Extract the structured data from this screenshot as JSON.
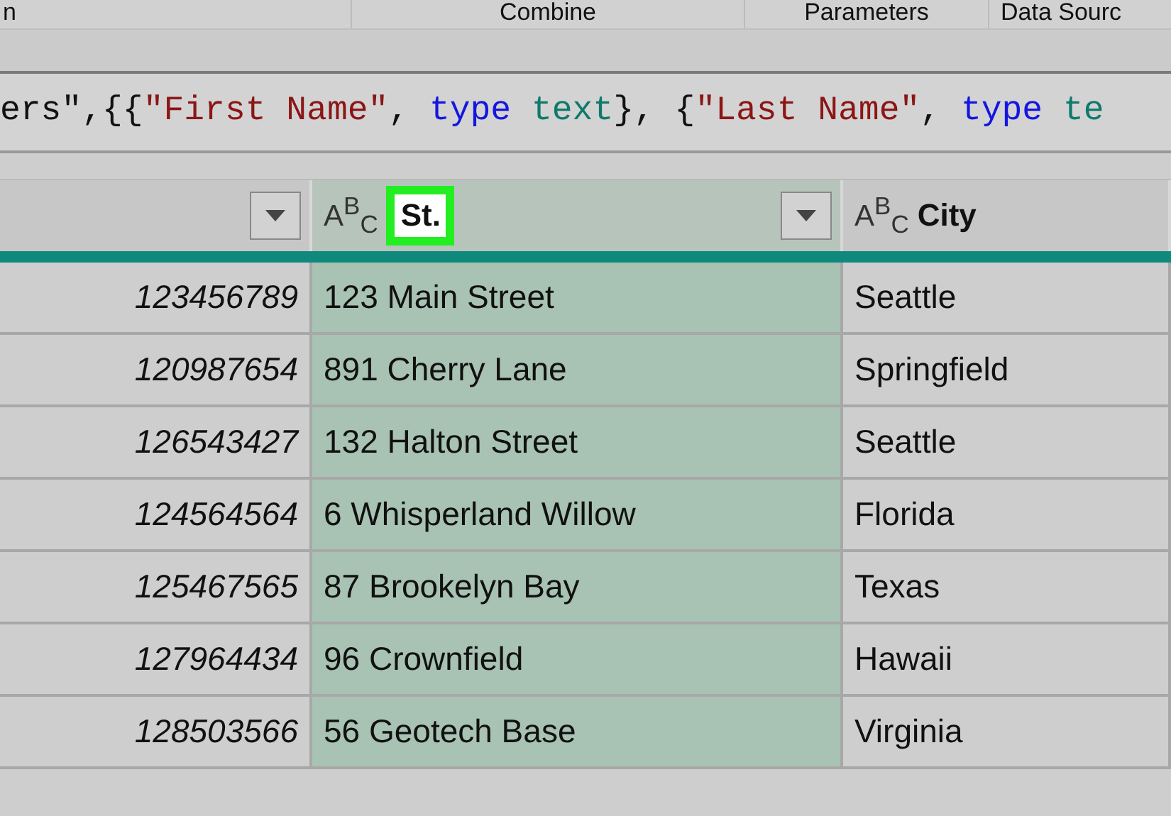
{
  "ribbon": {
    "groups": [
      "n",
      "Combine",
      "Parameters",
      "Data Sourc"
    ]
  },
  "formula_bar": {
    "tokens": [
      {
        "kind": "plain",
        "text": "ers\",{{"
      },
      {
        "kind": "string",
        "text": "\"First Name\""
      },
      {
        "kind": "plain",
        "text": ", "
      },
      {
        "kind": "keyword",
        "text": "type"
      },
      {
        "kind": "typename",
        "text": " text"
      },
      {
        "kind": "plain",
        "text": "}, {"
      },
      {
        "kind": "string",
        "text": "\"Last Name\""
      },
      {
        "kind": "plain",
        "text": ", "
      },
      {
        "kind": "keyword",
        "text": "type"
      },
      {
        "kind": "typename",
        "text": " te"
      }
    ]
  },
  "table": {
    "columns": [
      {
        "selected": false,
        "dropdown": true,
        "editing": false
      },
      {
        "type_icon": "A$^{B}$$_{C}$",
        "name": "St.",
        "selected": true,
        "dropdown": true,
        "editing": true
      },
      {
        "type_icon": "A$^{B}$$_{C}$",
        "name": "City",
        "selected": false,
        "dropdown": false,
        "editing": false
      }
    ],
    "rows": [
      [
        "123456789",
        "123 Main Street",
        "Seattle"
      ],
      [
        "120987654",
        "891 Cherry Lane",
        "Springfield"
      ],
      [
        "126543427",
        "132 Halton Street",
        "Seattle"
      ],
      [
        "124564564",
        "6 Whisperland Willow",
        "Florida"
      ],
      [
        "125467565",
        "87 Brookelyn Bay",
        "Texas"
      ],
      [
        "127964434",
        "96 Crownfield",
        "Hawaii"
      ],
      [
        "128503566",
        "56 Geotech Base",
        "Virginia"
      ]
    ]
  }
}
